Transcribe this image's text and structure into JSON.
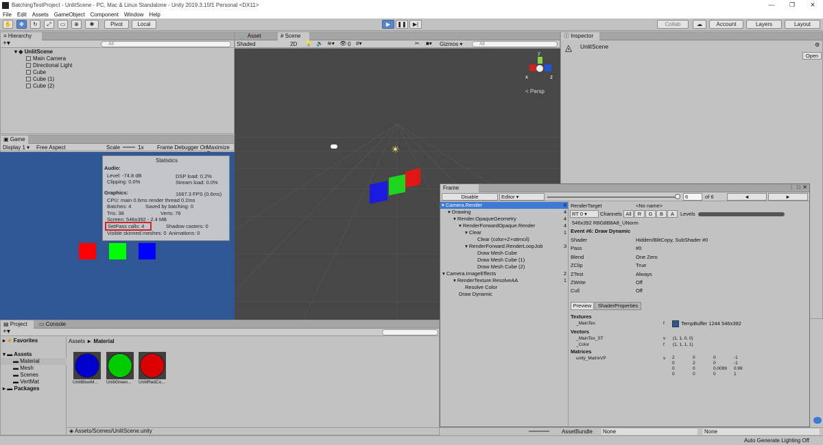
{
  "window": {
    "title": "BatchingTestProject - UnlitScene - PC, Mac & Linux Standalone - Unity 2019.3.15f1 Personal <DX11>"
  },
  "menu": [
    "File",
    "Edit",
    "Assets",
    "GameObject",
    "Component",
    "Window",
    "Help"
  ],
  "toolbar": {
    "pivot": "Pivot",
    "local": "Local",
    "collab": "Collab",
    "account": "Account",
    "layers": "Layers",
    "layout": "Layout"
  },
  "hierarchy": {
    "tab": "Hierarchy",
    "search_placeholder": "All",
    "scene": "UnlitScene",
    "items": [
      "Main Camera",
      "Directional Light",
      "Cube",
      "Cube (1)",
      "Cube (2)"
    ]
  },
  "scene_tabs": {
    "asset_store": "Asset Store",
    "scene": "Scene"
  },
  "scene_bar": {
    "shading": "Shaded",
    "mode": "2D",
    "gizmos": "Gizmos",
    "search_placeholder": "All",
    "fx_count": "0"
  },
  "gizmo": {
    "persp": "< Persp",
    "x": "x",
    "y": "y",
    "z": "z"
  },
  "inspector": {
    "tab": "Inspector",
    "object": "UnlitScene",
    "open": "Open"
  },
  "game": {
    "tab": "Game",
    "display": "Display 1",
    "aspect": "Free Aspect",
    "scale_label": "Scale",
    "scale_value": "1x",
    "frame_debugger": "Frame Debugger On",
    "maximize": "Maximize O"
  },
  "stats": {
    "title": "Statistics",
    "audio_header": "Audio:",
    "level": "Level: -74.8 dB",
    "dsp": "DSP load: 0.2%",
    "clipping": "Clipping: 0.0%",
    "stream": "Stream load: 0.0%",
    "graphics_header": "Graphics:",
    "fps": "1667.3 FPS (0.6ms)",
    "cpu": "CPU: main 0.6ms  render thread 0.2ms",
    "batches": "Batches: 4",
    "saved": "Saved by batching: 0",
    "tris": "Tris: 38",
    "verts": "Verts: 76",
    "screen": "Screen: 546x392 - 2.4 MB",
    "setpass": "SetPass calls: 4",
    "shadow": "Shadow casters: 0",
    "skinned": "Visible skinned meshes: 0",
    "animations": "Animations: 0"
  },
  "frame_debug": {
    "tab": "Frame Debug",
    "disable": "Disable",
    "editor": "Editor",
    "current": "6",
    "of": "of 6",
    "prev": "◄",
    "next": "►",
    "tree": [
      {
        "label": "Camera.Render",
        "count": "6"
      },
      {
        "label": "Drawing",
        "count": "4"
      },
      {
        "label": "Render.OpaqueGeometry",
        "count": "4"
      },
      {
        "label": "RenderForwardOpaque.Render",
        "count": "4"
      },
      {
        "label": "Clear",
        "count": "1"
      },
      {
        "label": "Clear (color+Z+stencil)",
        "count": ""
      },
      {
        "label": "RenderForward.RenderLoopJob",
        "count": "3"
      },
      {
        "label": "Draw Mesh Cube",
        "count": ""
      },
      {
        "label": "Draw Mesh Cube (1)",
        "count": ""
      },
      {
        "label": "Draw Mesh Cube (2)",
        "count": ""
      },
      {
        "label": "Camera.ImageEffects",
        "count": "2"
      },
      {
        "label": "RenderTexture.ResolveAA",
        "count": "1"
      },
      {
        "label": "Resolve Color",
        "count": ""
      },
      {
        "label": "Draw Dynamic",
        "count": ""
      }
    ],
    "render_target_label": "RenderTarget",
    "render_target_value": "<No name>",
    "rt": "RT 0",
    "channels": "Channels",
    "ch_all": "All",
    "ch_r": "R",
    "ch_g": "G",
    "ch_b": "B",
    "ch_a": "A",
    "levels": "Levels",
    "format": "546x392 R8G8B8A8_UNorm",
    "event": "Event #6: Draw Dynamic",
    "props": [
      {
        "k": "Shader",
        "v": "Hidden/BlitCopy, SubShader #0"
      },
      {
        "k": "Pass",
        "v": "#0"
      },
      {
        "k": "Blend",
        "v": "One Zero"
      },
      {
        "k": "ZClip",
        "v": "True"
      },
      {
        "k": "ZTest",
        "v": "Always"
      },
      {
        "k": "ZWrite",
        "v": "Off"
      },
      {
        "k": "Cull",
        "v": "Off"
      }
    ],
    "preview": "Preview",
    "shader_props": "ShaderProperties",
    "textures_header": "Textures",
    "maintex": "_MainTex",
    "maintex_stage": "f",
    "maintex_value": "TempBuffer 1244 546x392",
    "vectors_header": "Vectors",
    "vec1_name": "_MainTex_ST",
    "vec1_stage": "v",
    "vec1_value": "(1, 1, 0, 0)",
    "vec2_name": "_Color",
    "vec2_stage": "f",
    "vec2_value": "(1, 1, 1, 1)",
    "matrices_header": "Matrices",
    "mat_name": "unity_MatrixVP",
    "mat_stage": "v",
    "matrix": [
      [
        "2",
        "0",
        "0",
        "-1"
      ],
      [
        "0",
        "2",
        "0",
        "-1"
      ],
      [
        "0",
        "0",
        "0.0099",
        "0.99"
      ],
      [
        "0",
        "0",
        "0",
        "1"
      ]
    ]
  },
  "project": {
    "tab_project": "Project",
    "tab_console": "Console",
    "favorites": "Favorites",
    "assets": "Assets",
    "folders": [
      "Material",
      "Mesh",
      "Scenes",
      "VertMat"
    ],
    "packages": "Packages",
    "breadcrumb_assets": "Assets",
    "breadcrumb_sep": "►",
    "breadcrumb_material": "Material",
    "items": [
      {
        "name": "UnlitBlueM...",
        "color": "#0000cc"
      },
      {
        "name": "UnlitGreen...",
        "color": "#00cc00"
      },
      {
        "name": "UnlitRedCo...",
        "color": "#dd0000"
      }
    ],
    "path": "Assets/Scenes/UnlitScene.unity"
  },
  "asset_bundle": {
    "label": "AssetBundle",
    "value": "None",
    "variant": "None"
  },
  "status": {
    "lighting": "Auto Generate Lighting Off"
  },
  "colors": {
    "accent": "#3d7ad6",
    "highlight_red": "#e02020",
    "game_bg": "#2e5793",
    "scene_bg": "#474747"
  }
}
